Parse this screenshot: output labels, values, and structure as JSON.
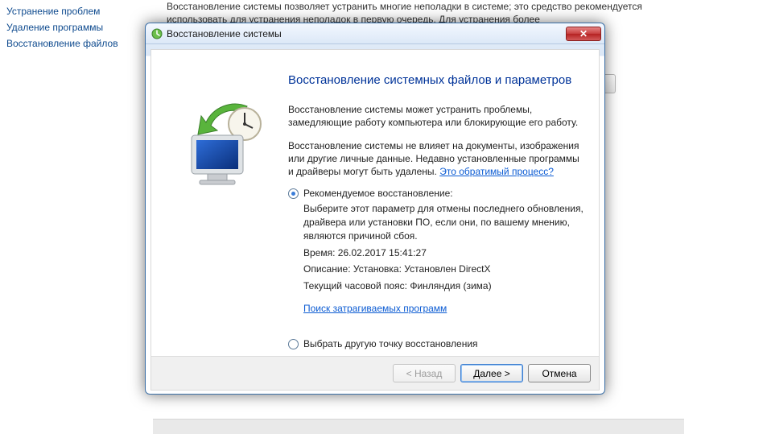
{
  "background": {
    "links": [
      "Устранение проблем",
      "Удаление программы",
      "Восстановление файлов"
    ],
    "text": "Восстановление системы позволяет устранить многие неполадки в системе; это средство рекомендуется использовать для устранения неполадок в первую очередь. Для устранения более"
  },
  "dialog": {
    "title": "Восстановление системы",
    "heading": "Восстановление системных файлов и параметров",
    "para1": "Восстановление системы может устранить проблемы, замедляющие работу компьютера или блокирующие его работу.",
    "para2_prefix": "Восстановление системы не влияет на документы, изображения или другие личные данные. Недавно установленные программы и драйверы могут быть удалены. ",
    "para2_link": "Это обратимый процесс?",
    "option_recommended": {
      "label": "Рекомендуемое восстановление:",
      "desc": "Выберите этот параметр для отмены последнего обновления, драйвера или установки ПО, если они, по вашему мнению, являются причиной сбоя.",
      "time": "Время: 26.02.2017 15:41:27",
      "description": "Описание: Установка: Установлен DirectX",
      "timezone": "Текущий часовой пояс: Финляндия (зима)",
      "affected_link": "Поиск затрагиваемых программ"
    },
    "option_choose": {
      "label": "Выбрать другую точку восстановления"
    },
    "buttons": {
      "back": "< Назад",
      "next": "Далее >",
      "cancel": "Отмена"
    }
  }
}
